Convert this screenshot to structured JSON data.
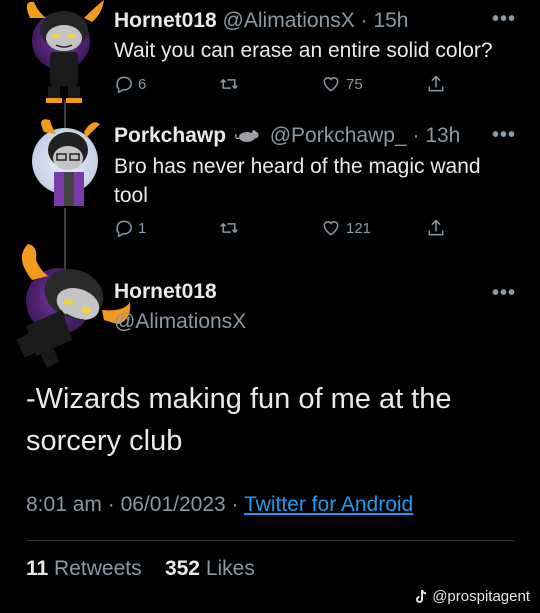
{
  "tweets": [
    {
      "name": "Hornet018",
      "handle": "@AlimationsX",
      "dot": "·",
      "time": "15h",
      "text": "Wait you can erase an entire solid color?",
      "replies": "6",
      "likes": "75"
    },
    {
      "name": "Porkchawp",
      "handle": "@Porkchawp_",
      "dot": "·",
      "time": "13h",
      "text": "Bro has never heard of the magic wand tool",
      "replies": "1",
      "likes": "121"
    }
  ],
  "main": {
    "name": "Hornet018",
    "handle": "@AlimationsX",
    "text": "-Wizards making fun of me at the sorcery club",
    "time": "8:01 am",
    "sep": "·",
    "date": "06/01/2023",
    "source": "Twitter for Android",
    "retweets_count": "11",
    "retweets_label": "Retweets",
    "likes_count": "352",
    "likes_label": "Likes"
  },
  "more_label": "•••",
  "watermark": "@prospitagent",
  "colors": {
    "background": "#000000",
    "text": "#e7e9ea",
    "secondary": "#8b98a5",
    "link": "#1d9bf0",
    "divider": "#2f3336",
    "horn": "#f29a1e"
  },
  "icons": [
    "reply-icon",
    "retweet-icon",
    "like-icon",
    "share-icon",
    "rat-emoji-icon",
    "tiktok-icon"
  ]
}
